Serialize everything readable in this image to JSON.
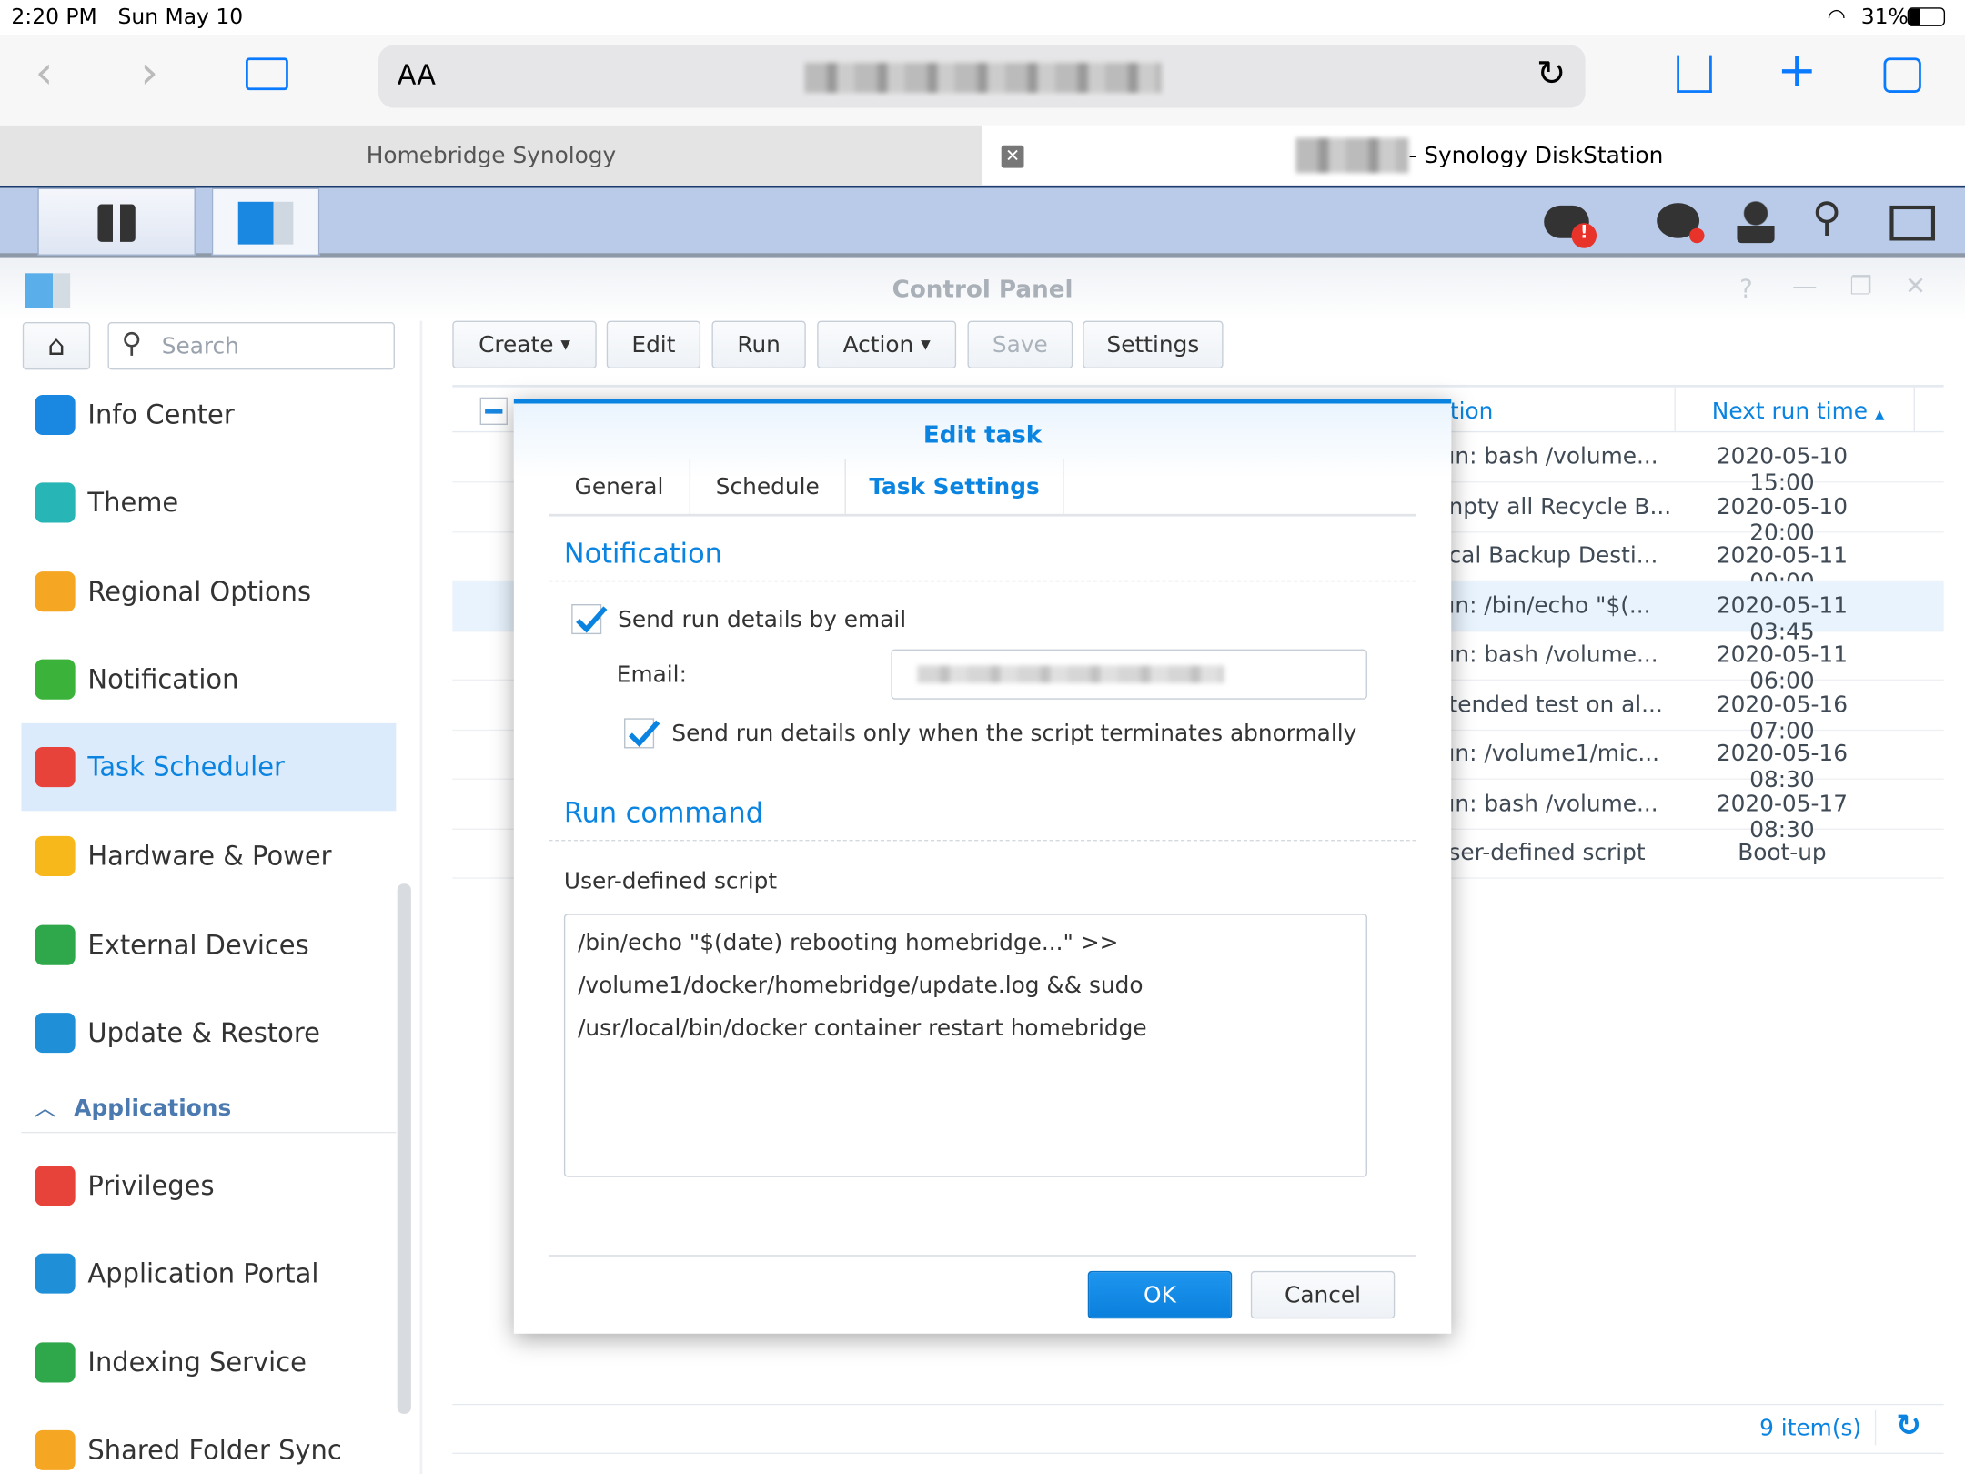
{
  "status": {
    "time": "2:20 PM",
    "date": "Sun May 10",
    "battery": "31%"
  },
  "safari": {
    "text_size_label": "AA"
  },
  "tabs": [
    {
      "label": "Homebridge Synology"
    },
    {
      "label": "- Synology DiskStation"
    }
  ],
  "window": {
    "title": "Control Panel"
  },
  "sidebar": {
    "search_placeholder": "Search",
    "items": [
      {
        "label": "Info Center",
        "color": "#1a87e0"
      },
      {
        "label": "Theme",
        "color": "#27b5b5"
      },
      {
        "label": "Regional Options",
        "color": "#f5a623"
      },
      {
        "label": "Notification",
        "color": "#3bb33b"
      },
      {
        "label": "Task Scheduler",
        "color": "#e8433a"
      },
      {
        "label": "Hardware & Power",
        "color": "#f7b81c"
      },
      {
        "label": "External Devices",
        "color": "#2ea84a"
      },
      {
        "label": "Update & Restore",
        "color": "#1f8fd8"
      }
    ],
    "section": "Applications",
    "apps": [
      {
        "label": "Privileges",
        "color": "#e8433a"
      },
      {
        "label": "Application Portal",
        "color": "#1f8fd8"
      },
      {
        "label": "Indexing Service",
        "color": "#2ea84a"
      },
      {
        "label": "Shared Folder Sync",
        "color": "#f5a623"
      }
    ]
  },
  "toolbar": {
    "create": "Create",
    "edit": "Edit",
    "run": "Run",
    "action": "Action",
    "save": "Save",
    "settings": "Settings"
  },
  "table": {
    "col_action": "tion",
    "col_next": "Next run time",
    "rows": [
      {
        "action": "ın: bash /volume...",
        "next": "2020-05-10 15:00"
      },
      {
        "action": "npty all Recycle B...",
        "next": "2020-05-10 20:00"
      },
      {
        "action": "cal Backup Desti...",
        "next": "2020-05-11 00:00"
      },
      {
        "action": "ın: /bin/echo \"$(...",
        "next": "2020-05-11 03:45"
      },
      {
        "action": "ın: bash /volume...",
        "next": "2020-05-11 06:00"
      },
      {
        "action": "tended test on al...",
        "next": "2020-05-16 07:00"
      },
      {
        "action": "ın: /volume1/mic...",
        "next": "2020-05-16 08:30"
      },
      {
        "action": "ın: bash /volume...",
        "next": "2020-05-17 08:30"
      },
      {
        "action": "ser-defined script",
        "next": "Boot-up"
      }
    ],
    "count": "9 item(s)"
  },
  "modal": {
    "title": "Edit task",
    "tabs": [
      "General",
      "Schedule",
      "Task Settings"
    ],
    "active_tab": "Task Settings",
    "notification_title": "Notification",
    "send_email_label": "Send run details by email",
    "send_email_checked": true,
    "email_label": "Email:",
    "abnormal_label": "Send run details only when the script terminates abnormally",
    "abnormal_checked": true,
    "run_title": "Run command",
    "script_label": "User-defined script",
    "script": "/bin/echo \"$(date) rebooting homebridge...\" >> /volume1/docker/homebridge/update.log && sudo /usr/local/bin/docker container restart homebridge",
    "ok": "OK",
    "cancel": "Cancel"
  },
  "colors": {
    "accent": "#0a84e0",
    "selected": "#dcebfb",
    "taskbar": "#b9cbe9"
  }
}
